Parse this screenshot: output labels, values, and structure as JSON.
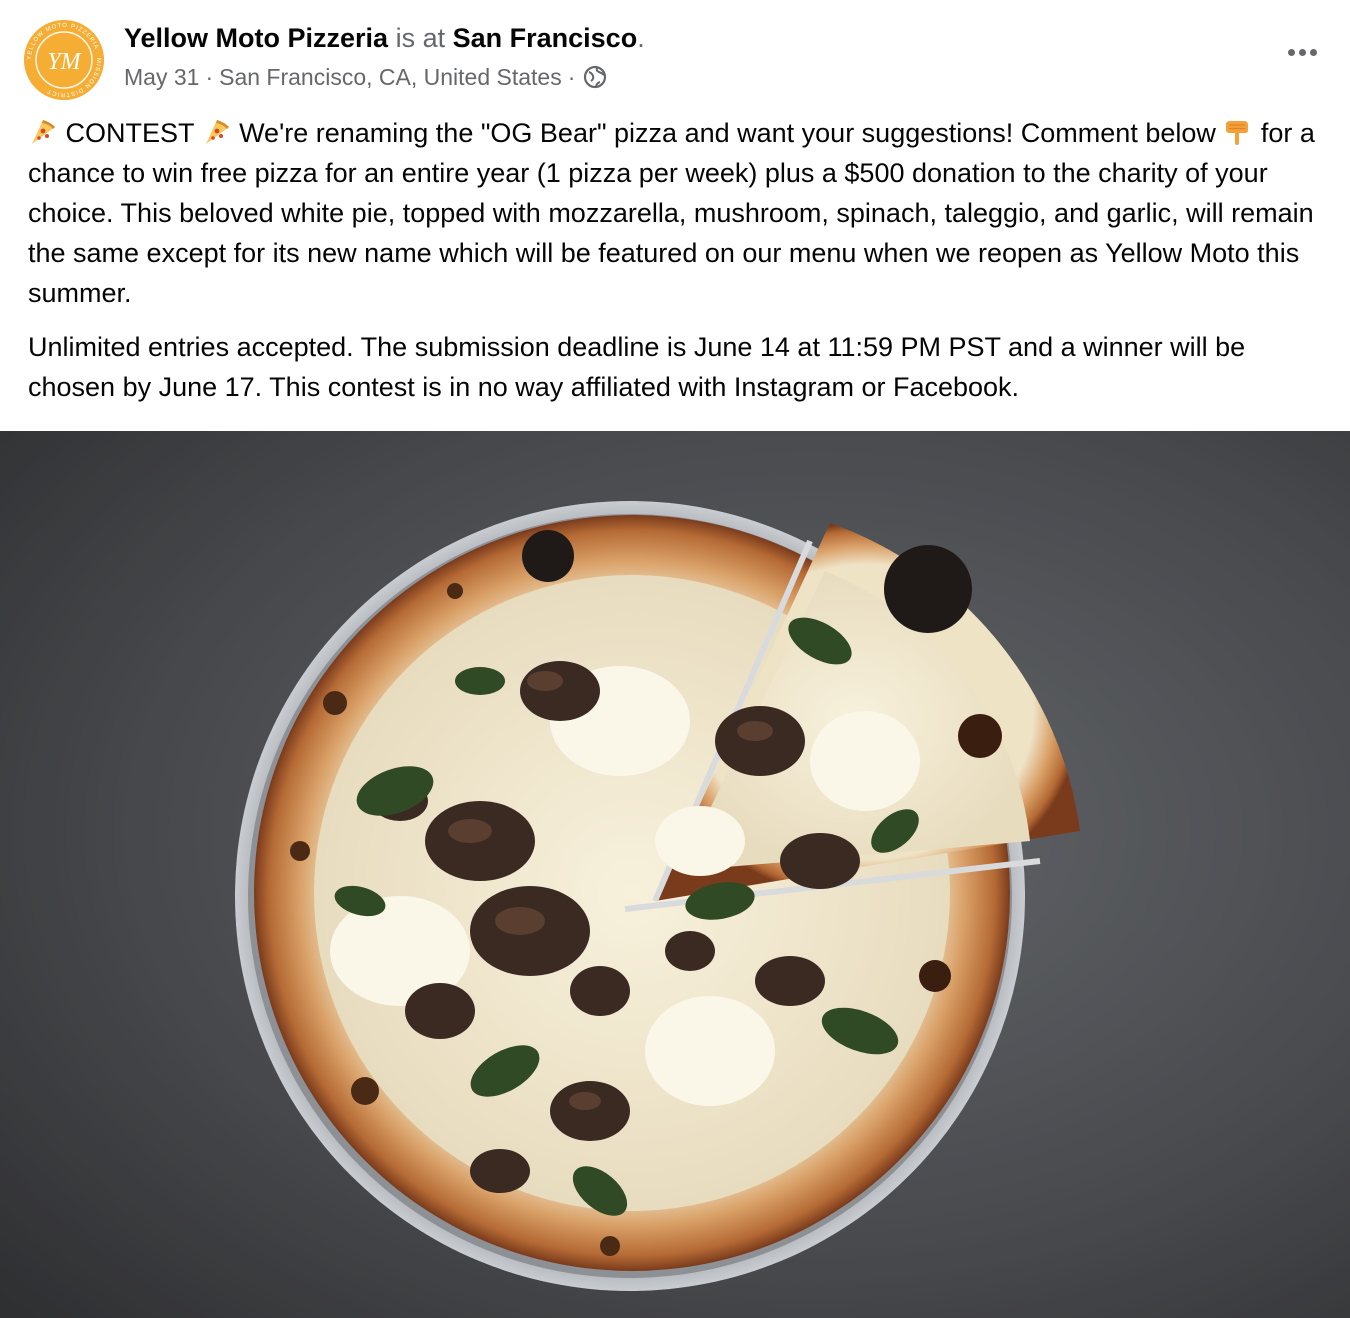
{
  "post": {
    "page_name": "Yellow Moto Pizzeria",
    "is_at_text": "is at",
    "location_link": "San Francisco",
    "period": ".",
    "date": "May 31",
    "separator": "·",
    "place": "San Francisco, CA, United States",
    "privacy_icon": "globe-icon",
    "more_icon": "more-options-icon",
    "avatar_monogram": "YM",
    "avatar_ring_text": "YELLOW MOTO PIZZERIA · MISSION DISTRICT",
    "brand_color": "#F5AD34"
  },
  "text": {
    "p1_contest": "CONTEST",
    "p1_a": "We're renaming the \"OG Bear\" pizza and want your suggestions! Comment below",
    "p1_b": "for a chance to win free pizza for an entire year (1 pizza per week) plus a $500 donation to the charity of your choice. This beloved white pie, topped with mozzarella, mushroom, spinach, taleggio, and garlic, will remain the same except for its new name which will be featured on our menu when we reopen as Yellow Moto this summer.",
    "p2": "Unlimited entries accepted. The submission deadline is June 14 at 11:59 PM PST and a winner will be chosen by June 17. This contest is in no way affiliated with Instagram or Facebook."
  },
  "emojis": [
    "pizza-slice-emoji",
    "pizza-slice-emoji",
    "pointing-down-emoji"
  ],
  "image": {
    "subject": "pizza-photo"
  }
}
